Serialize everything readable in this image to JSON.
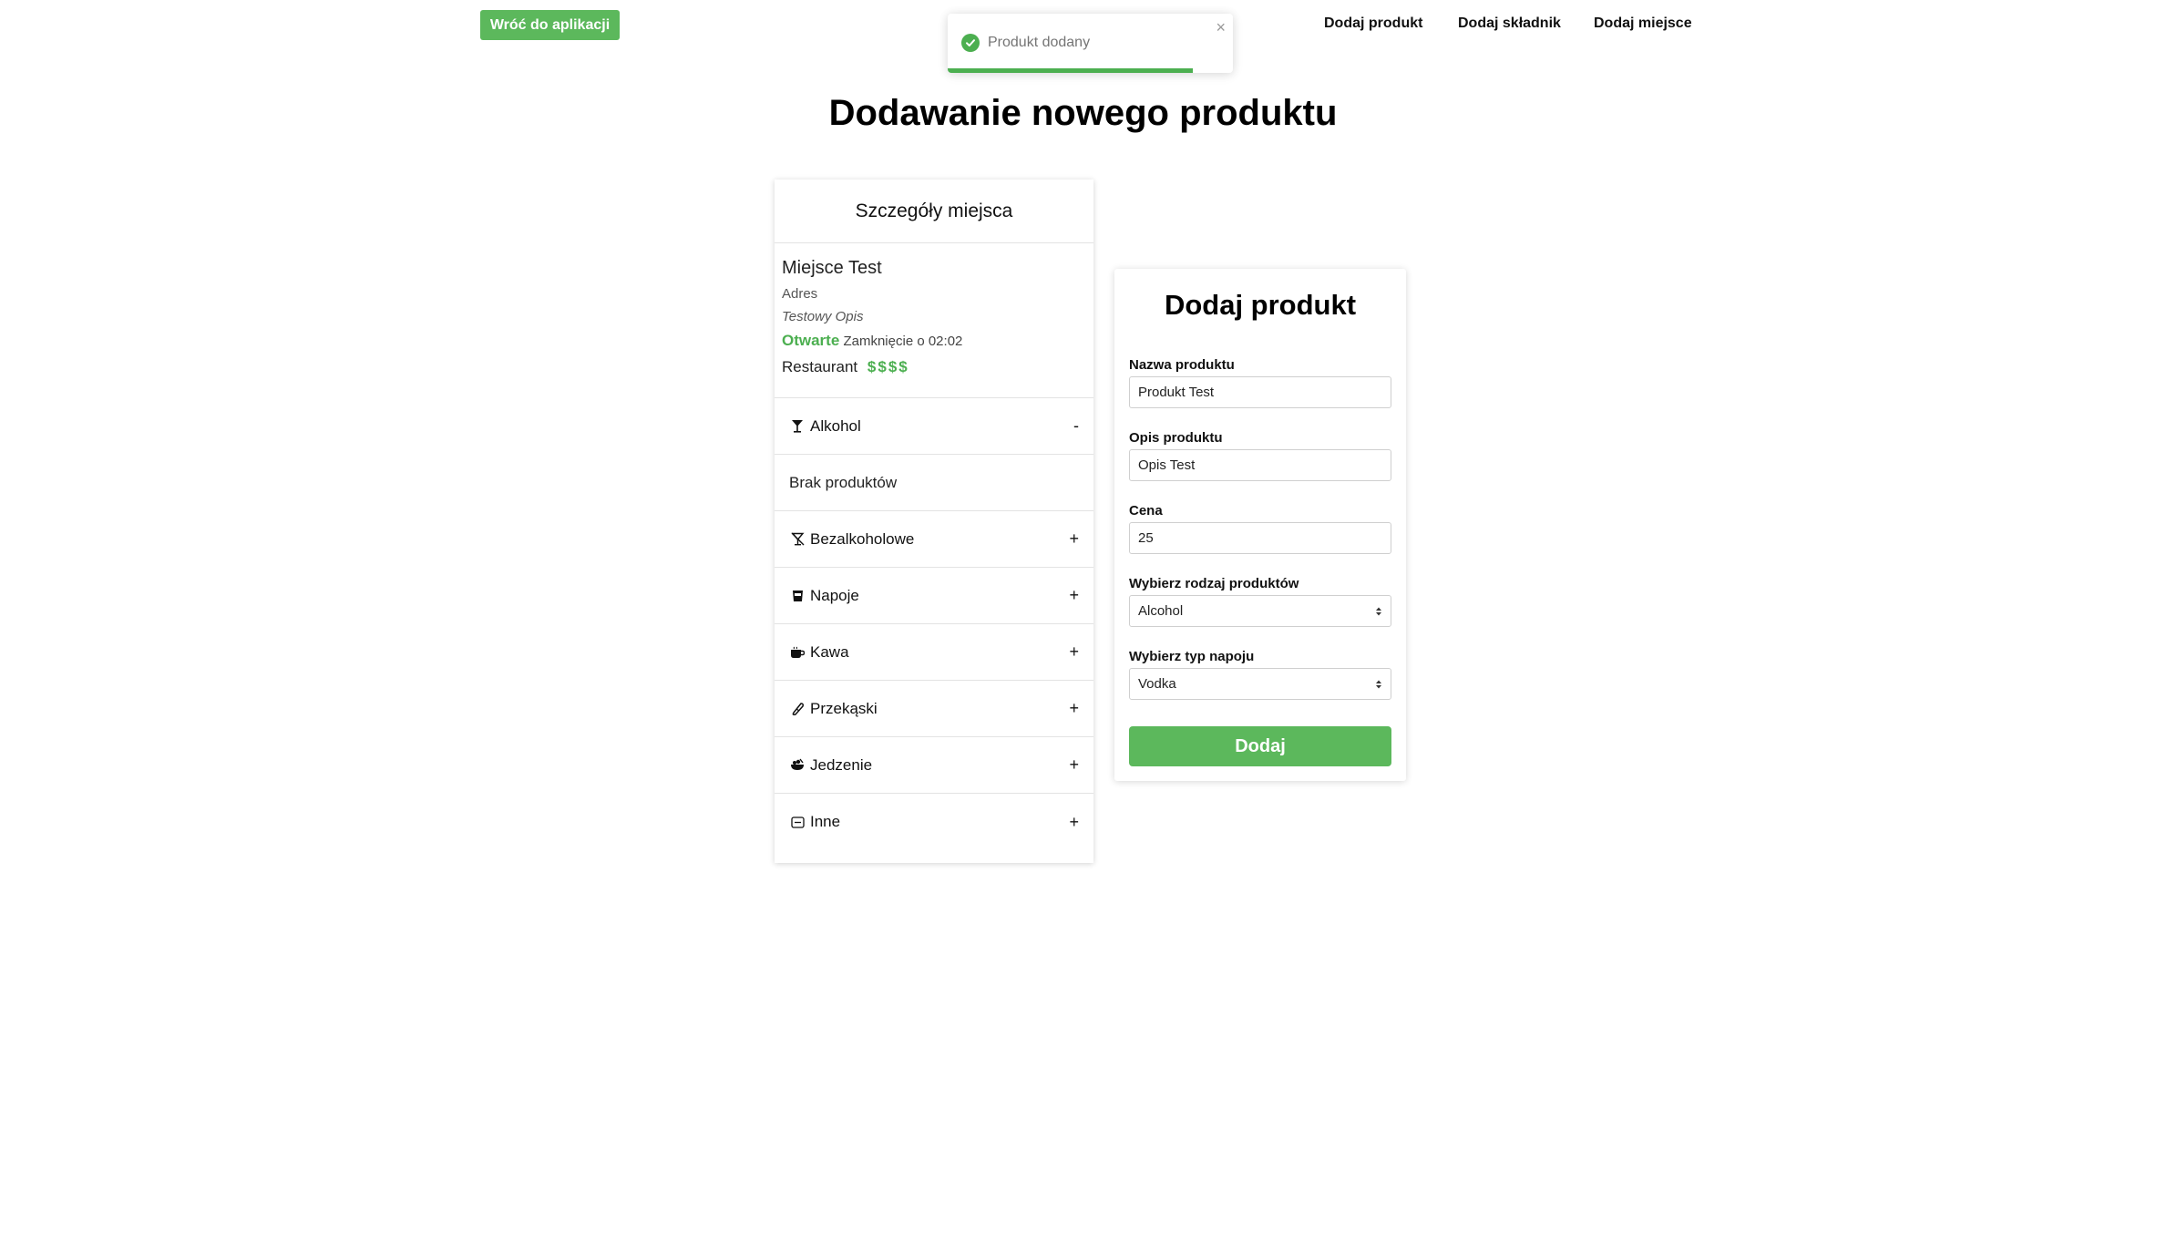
{
  "top_bar": {
    "back_label": "Wróć do aplikacji",
    "nav": [
      "Dodaj produkt",
      "Dodaj składnik",
      "Dodaj miejsce"
    ]
  },
  "toast": {
    "message": "Produkt dodany",
    "close": "×",
    "progress": 0.86,
    "color": "#4caf50"
  },
  "page_title": "Dodawanie nowego produktu",
  "place": {
    "header": "Szczegóły miejsca",
    "name": "Miejsce Test",
    "address": "Adres",
    "description": "Testowy Opis",
    "status": "Otwarte",
    "closing": "Zamknięcie o 02:02",
    "type": "Restaurant",
    "price_level": "$$$$",
    "categories": [
      {
        "icon": "cocktail-icon",
        "glyph": "🍸",
        "label": "Alkohol",
        "toggle": "-"
      },
      {
        "icon": "",
        "glyph": "",
        "label": "Brak produktów",
        "toggle": ""
      },
      {
        "icon": "no-alcohol-icon",
        "glyph": "⊗",
        "label": "Bezalkoholowe",
        "toggle": "+"
      },
      {
        "icon": "drink-can-icon",
        "glyph": "🥤",
        "label": "Napoje",
        "toggle": "+"
      },
      {
        "icon": "coffee-icon",
        "glyph": "☕",
        "label": "Kawa",
        "toggle": "+"
      },
      {
        "icon": "snack-icon",
        "glyph": "🍪",
        "label": "Przekąski",
        "toggle": "+"
      },
      {
        "icon": "food-bowl-icon",
        "glyph": "🍲",
        "label": "Jedzenie",
        "toggle": "+"
      },
      {
        "icon": "other-icon",
        "glyph": "⊖",
        "label": "Inne",
        "toggle": "+"
      }
    ]
  },
  "form": {
    "title": "Dodaj produkt",
    "name_label": "Nazwa produktu",
    "name_value": "Produkt Test",
    "desc_label": "Opis produktu",
    "desc_value": "Opis Test",
    "price_label": "Cena",
    "price_value": "25",
    "kind_label": "Wybierz rodzaj produktów",
    "kind_value": "Alcohol",
    "drink_label": "Wybierz typ napoju",
    "drink_value": "Vodka",
    "submit": "Dodaj"
  },
  "colors": {
    "accent_green": "#5cb85c",
    "status_green": "#4caf50"
  }
}
